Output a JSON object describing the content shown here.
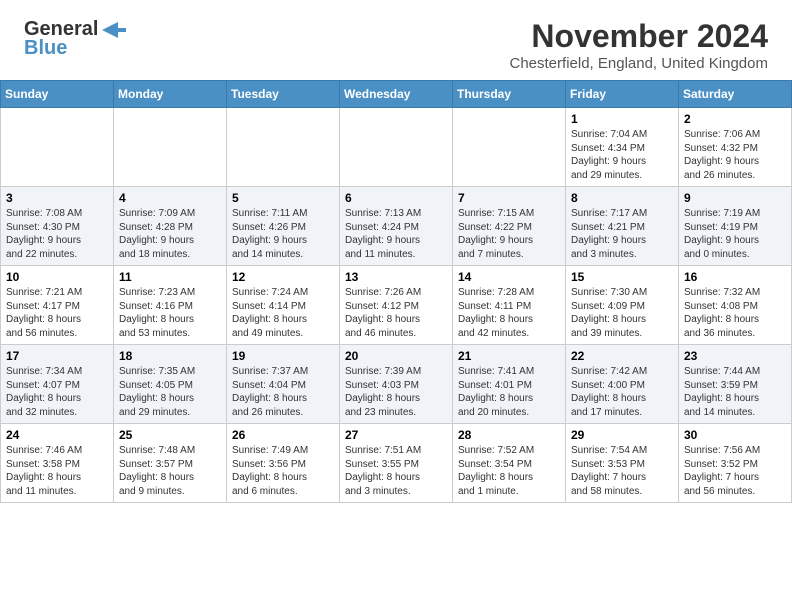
{
  "header": {
    "logo_general": "General",
    "logo_blue": "Blue",
    "month_year": "November 2024",
    "location": "Chesterfield, England, United Kingdom"
  },
  "days_of_week": [
    "Sunday",
    "Monday",
    "Tuesday",
    "Wednesday",
    "Thursday",
    "Friday",
    "Saturday"
  ],
  "weeks": [
    [
      {
        "day": "",
        "info": ""
      },
      {
        "day": "",
        "info": ""
      },
      {
        "day": "",
        "info": ""
      },
      {
        "day": "",
        "info": ""
      },
      {
        "day": "",
        "info": ""
      },
      {
        "day": "1",
        "info": "Sunrise: 7:04 AM\nSunset: 4:34 PM\nDaylight: 9 hours\nand 29 minutes."
      },
      {
        "day": "2",
        "info": "Sunrise: 7:06 AM\nSunset: 4:32 PM\nDaylight: 9 hours\nand 26 minutes."
      }
    ],
    [
      {
        "day": "3",
        "info": "Sunrise: 7:08 AM\nSunset: 4:30 PM\nDaylight: 9 hours\nand 22 minutes."
      },
      {
        "day": "4",
        "info": "Sunrise: 7:09 AM\nSunset: 4:28 PM\nDaylight: 9 hours\nand 18 minutes."
      },
      {
        "day": "5",
        "info": "Sunrise: 7:11 AM\nSunset: 4:26 PM\nDaylight: 9 hours\nand 14 minutes."
      },
      {
        "day": "6",
        "info": "Sunrise: 7:13 AM\nSunset: 4:24 PM\nDaylight: 9 hours\nand 11 minutes."
      },
      {
        "day": "7",
        "info": "Sunrise: 7:15 AM\nSunset: 4:22 PM\nDaylight: 9 hours\nand 7 minutes."
      },
      {
        "day": "8",
        "info": "Sunrise: 7:17 AM\nSunset: 4:21 PM\nDaylight: 9 hours\nand 3 minutes."
      },
      {
        "day": "9",
        "info": "Sunrise: 7:19 AM\nSunset: 4:19 PM\nDaylight: 9 hours\nand 0 minutes."
      }
    ],
    [
      {
        "day": "10",
        "info": "Sunrise: 7:21 AM\nSunset: 4:17 PM\nDaylight: 8 hours\nand 56 minutes."
      },
      {
        "day": "11",
        "info": "Sunrise: 7:23 AM\nSunset: 4:16 PM\nDaylight: 8 hours\nand 53 minutes."
      },
      {
        "day": "12",
        "info": "Sunrise: 7:24 AM\nSunset: 4:14 PM\nDaylight: 8 hours\nand 49 minutes."
      },
      {
        "day": "13",
        "info": "Sunrise: 7:26 AM\nSunset: 4:12 PM\nDaylight: 8 hours\nand 46 minutes."
      },
      {
        "day": "14",
        "info": "Sunrise: 7:28 AM\nSunset: 4:11 PM\nDaylight: 8 hours\nand 42 minutes."
      },
      {
        "day": "15",
        "info": "Sunrise: 7:30 AM\nSunset: 4:09 PM\nDaylight: 8 hours\nand 39 minutes."
      },
      {
        "day": "16",
        "info": "Sunrise: 7:32 AM\nSunset: 4:08 PM\nDaylight: 8 hours\nand 36 minutes."
      }
    ],
    [
      {
        "day": "17",
        "info": "Sunrise: 7:34 AM\nSunset: 4:07 PM\nDaylight: 8 hours\nand 32 minutes."
      },
      {
        "day": "18",
        "info": "Sunrise: 7:35 AM\nSunset: 4:05 PM\nDaylight: 8 hours\nand 29 minutes."
      },
      {
        "day": "19",
        "info": "Sunrise: 7:37 AM\nSunset: 4:04 PM\nDaylight: 8 hours\nand 26 minutes."
      },
      {
        "day": "20",
        "info": "Sunrise: 7:39 AM\nSunset: 4:03 PM\nDaylight: 8 hours\nand 23 minutes."
      },
      {
        "day": "21",
        "info": "Sunrise: 7:41 AM\nSunset: 4:01 PM\nDaylight: 8 hours\nand 20 minutes."
      },
      {
        "day": "22",
        "info": "Sunrise: 7:42 AM\nSunset: 4:00 PM\nDaylight: 8 hours\nand 17 minutes."
      },
      {
        "day": "23",
        "info": "Sunrise: 7:44 AM\nSunset: 3:59 PM\nDaylight: 8 hours\nand 14 minutes."
      }
    ],
    [
      {
        "day": "24",
        "info": "Sunrise: 7:46 AM\nSunset: 3:58 PM\nDaylight: 8 hours\nand 11 minutes."
      },
      {
        "day": "25",
        "info": "Sunrise: 7:48 AM\nSunset: 3:57 PM\nDaylight: 8 hours\nand 9 minutes."
      },
      {
        "day": "26",
        "info": "Sunrise: 7:49 AM\nSunset: 3:56 PM\nDaylight: 8 hours\nand 6 minutes."
      },
      {
        "day": "27",
        "info": "Sunrise: 7:51 AM\nSunset: 3:55 PM\nDaylight: 8 hours\nand 3 minutes."
      },
      {
        "day": "28",
        "info": "Sunrise: 7:52 AM\nSunset: 3:54 PM\nDaylight: 8 hours\nand 1 minute."
      },
      {
        "day": "29",
        "info": "Sunrise: 7:54 AM\nSunset: 3:53 PM\nDaylight: 7 hours\nand 58 minutes."
      },
      {
        "day": "30",
        "info": "Sunrise: 7:56 AM\nSunset: 3:52 PM\nDaylight: 7 hours\nand 56 minutes."
      }
    ]
  ]
}
